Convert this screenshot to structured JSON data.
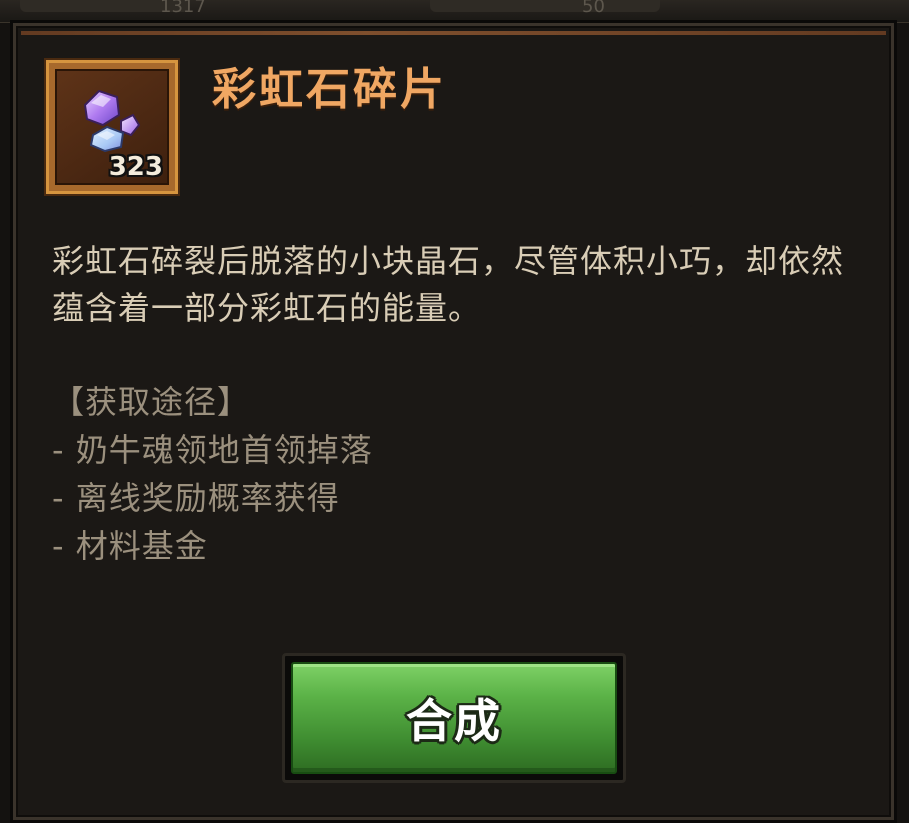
{
  "top_bar": {
    "left_fragment": "1317",
    "right_fragment": "50"
  },
  "item": {
    "name": "彩虹石碎片",
    "count": "323",
    "icon": "rainbow-stone-fragment-icon",
    "description": "彩虹石碎裂后脱落的小块晶石，尽管体积小巧，却依然蕴含着一部分彩虹石的能量。"
  },
  "sources": {
    "heading": "【获取途径】",
    "items": [
      "- 奶牛魂领地首领掉落",
      "- 离线奖励概率获得",
      "- 材料基金"
    ]
  },
  "actions": {
    "synthesize_label": "合成"
  },
  "colors": {
    "title": "#f0a763",
    "description": "#d9cdb6",
    "sources": "#9b907e",
    "button_green": "#5bb247",
    "icon_frame": "#d6953f"
  }
}
